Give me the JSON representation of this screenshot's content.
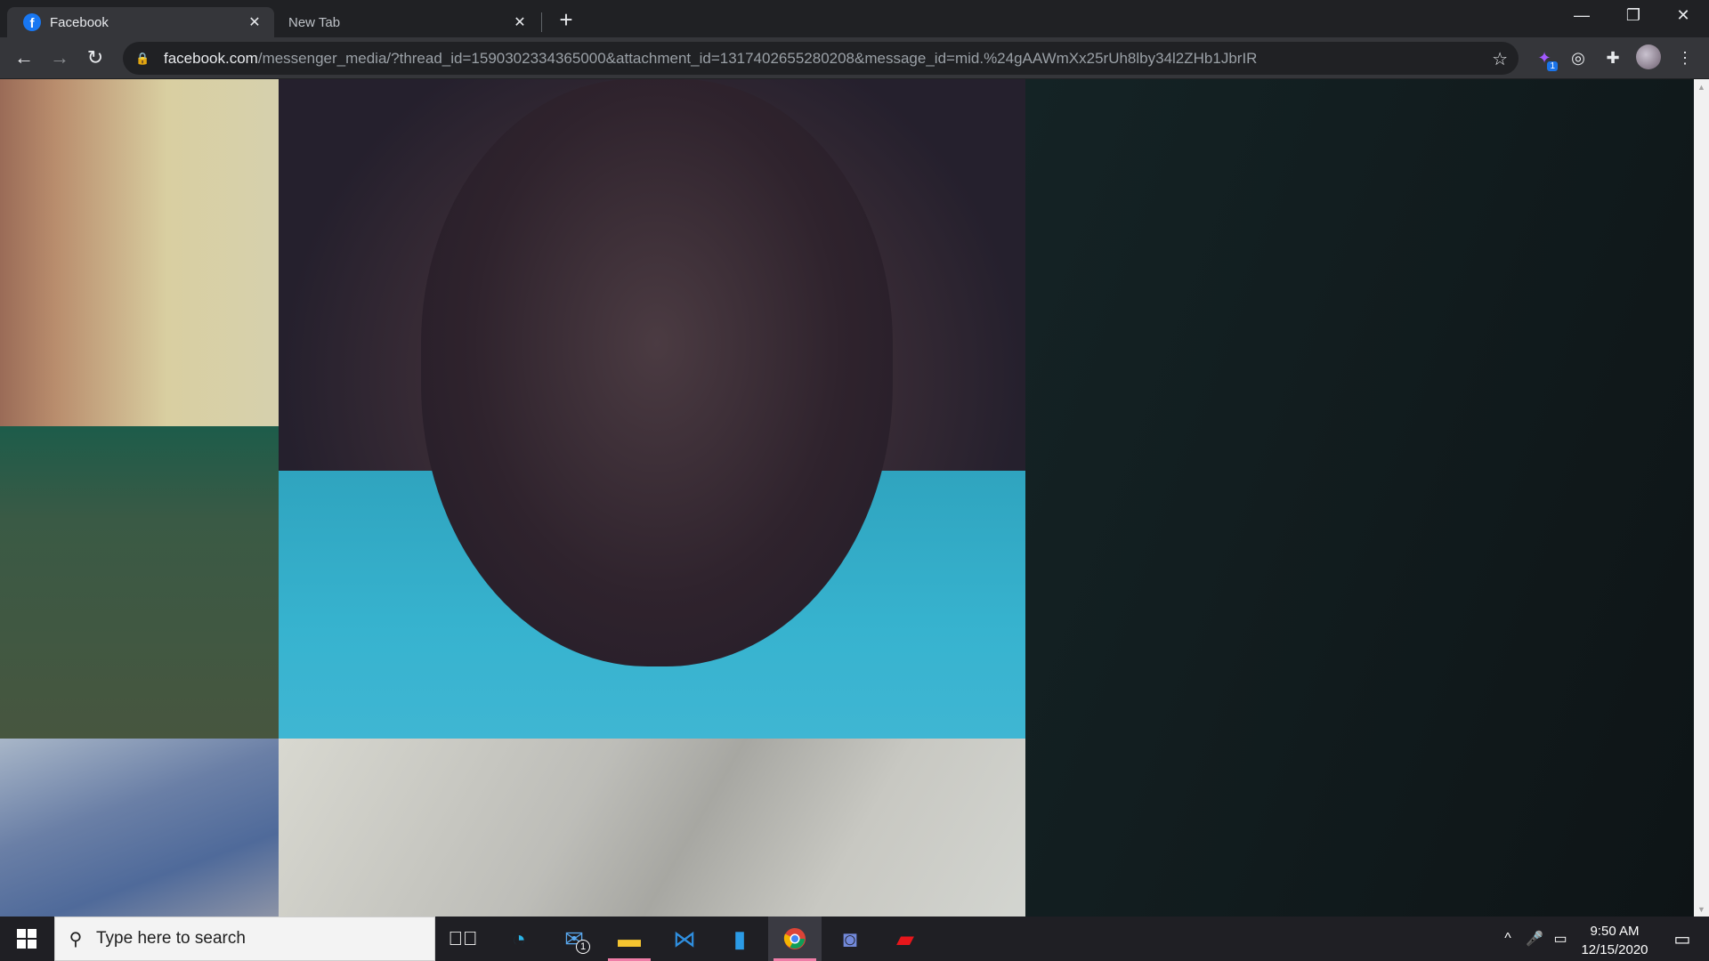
{
  "browser": {
    "tabs": [
      {
        "title": "Facebook",
        "favicon": "facebook-icon",
        "active": true
      },
      {
        "title": "New Tab",
        "active": false
      }
    ],
    "url_host": "facebook.com",
    "url_path": "/messenger_media/?thread_id=1590302334365000&attachment_id=1317402655280208&message_id=mid.%24gAAWmXx25rUh8lby34l2ZHb1JbrIR",
    "extension_badge": "1",
    "window_controls": [
      "minimize-icon",
      "restore-icon",
      "close-icon"
    ]
  },
  "taskbar": {
    "search_placeholder": "Type here to search",
    "pinned_apps": [
      "task-view-icon",
      "edge-icon",
      "mail-icon",
      "file-explorer-icon",
      "vscode-icon",
      "phone-app-icon",
      "chrome-icon",
      "discord-icon",
      "acrobat-icon"
    ],
    "mail_badge": "1",
    "time": "9:50 AM",
    "date": "12/15/2020"
  },
  "colors": {
    "chrome_dark": "#35363a",
    "tabstrip": "#202124",
    "taskbar": "#1f1f24",
    "facebook_blue": "#1877f2"
  }
}
